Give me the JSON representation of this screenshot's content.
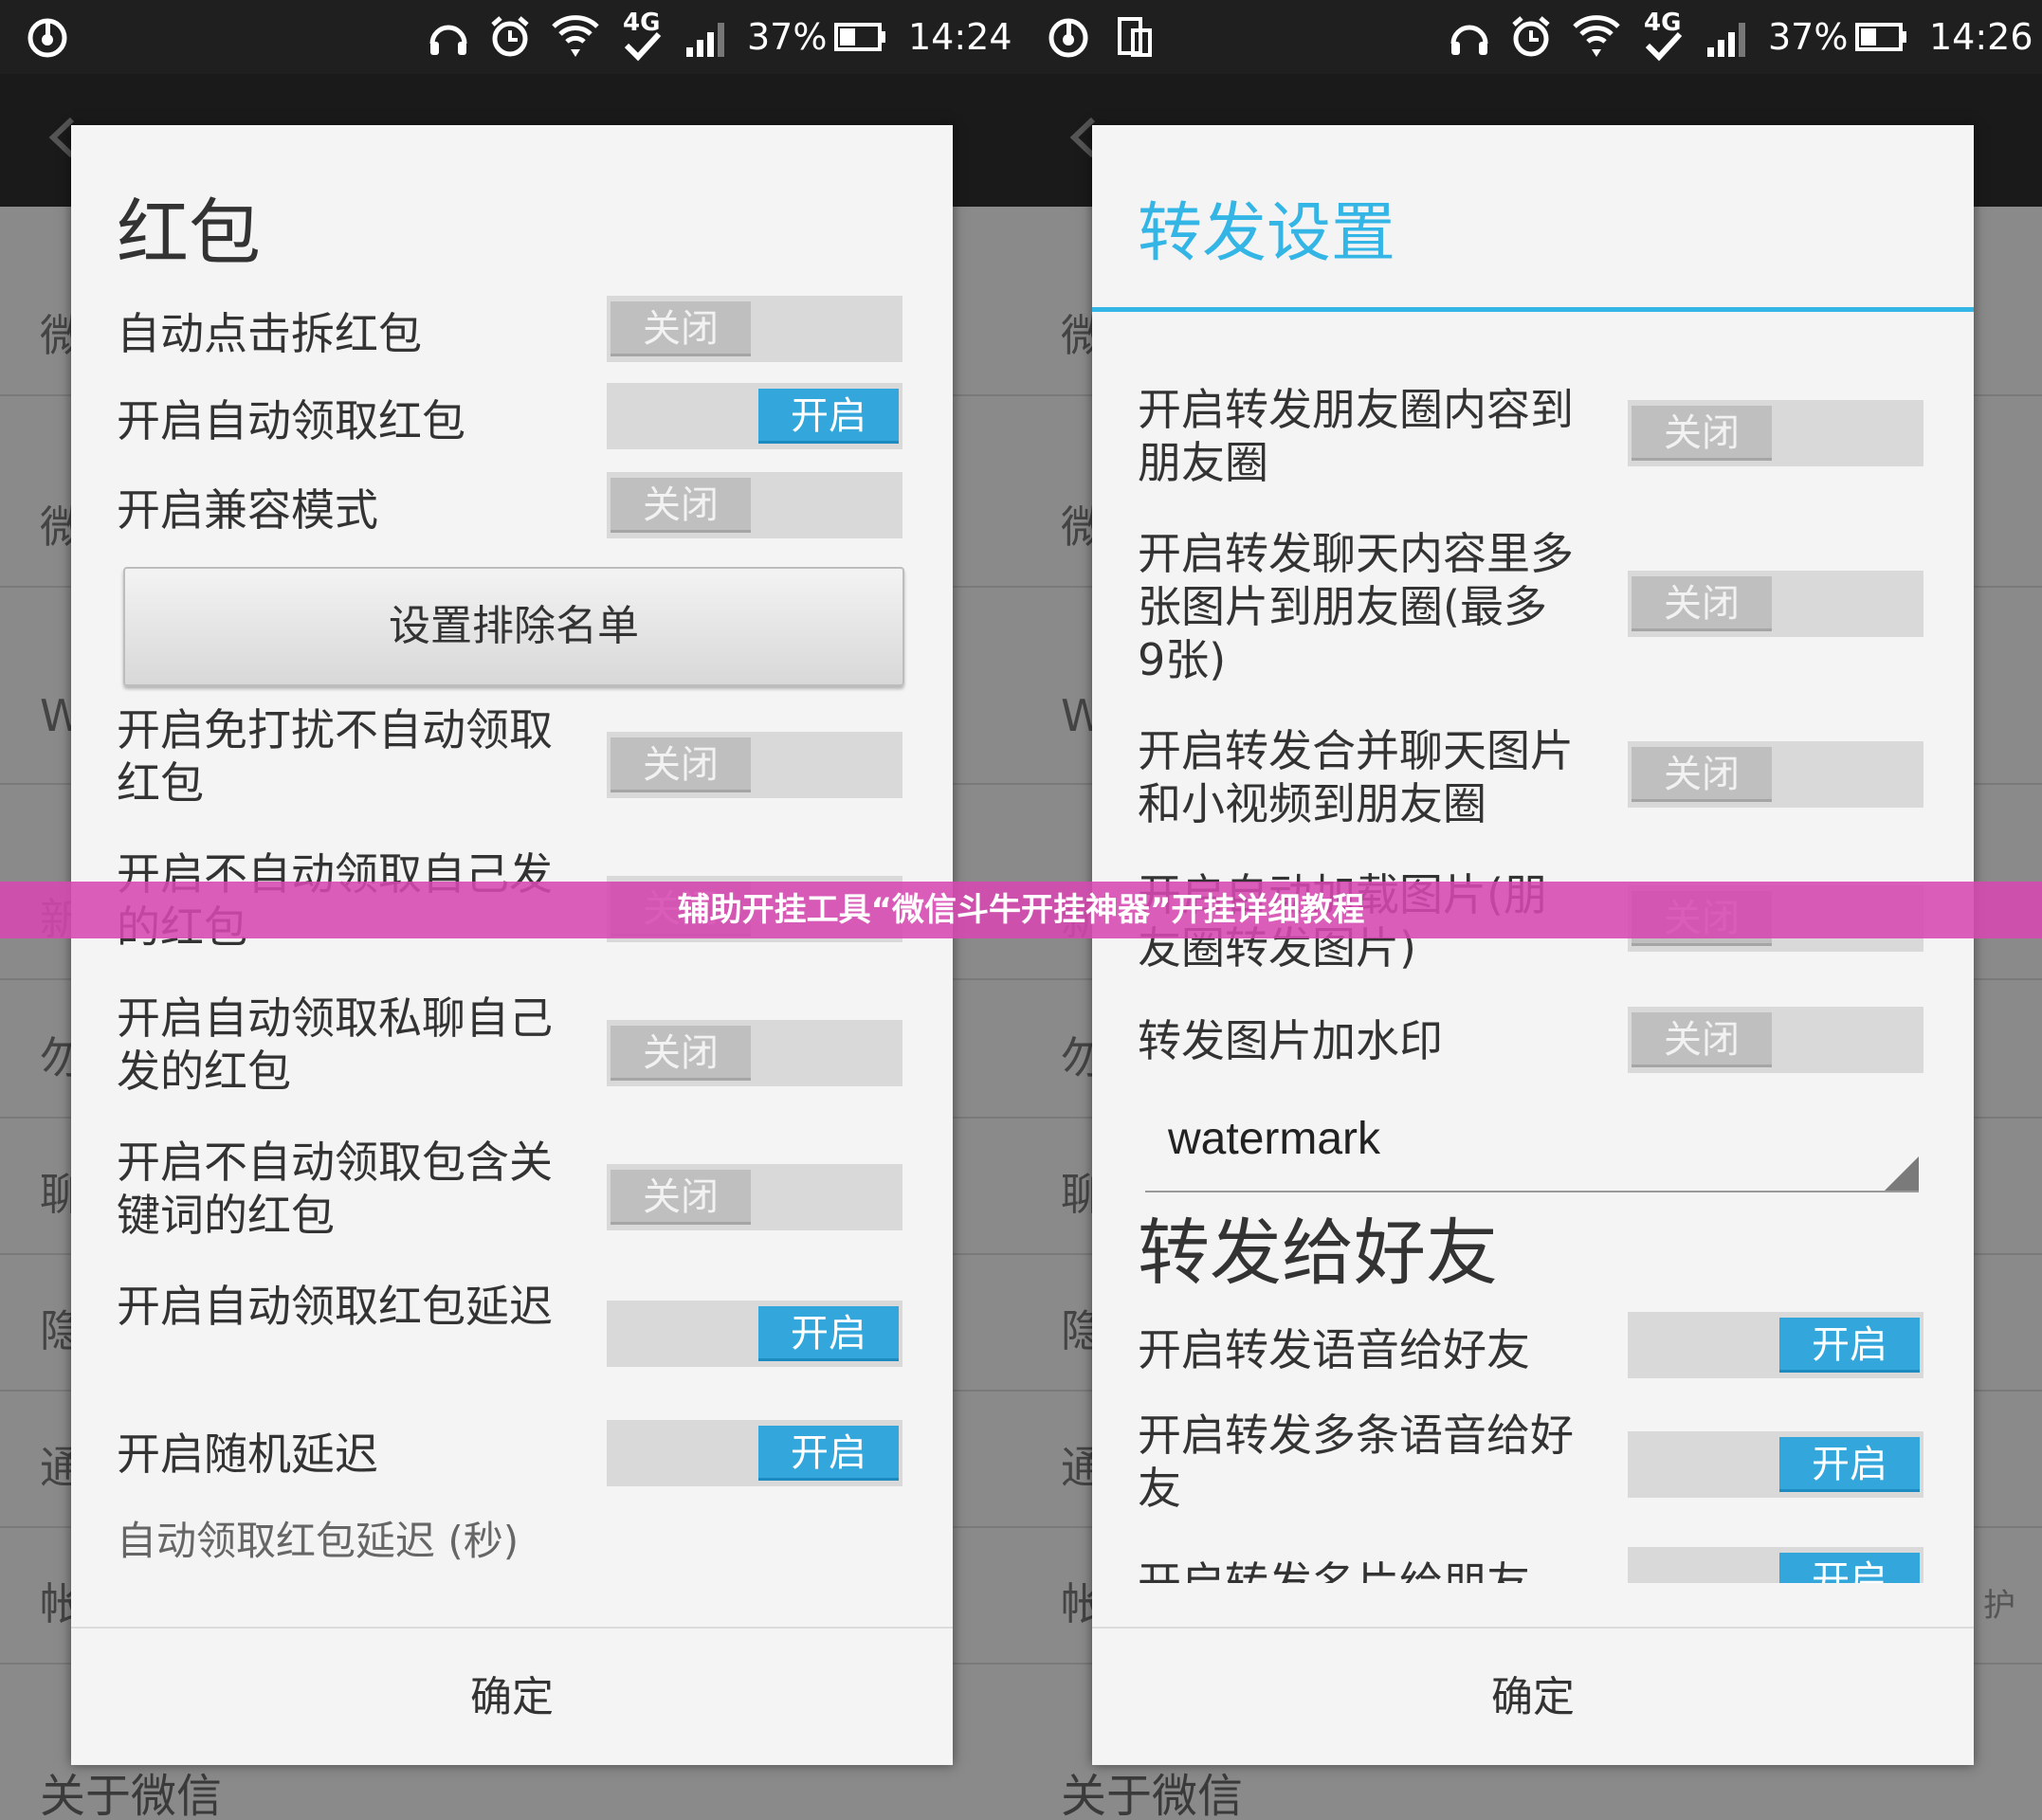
{
  "left_screen": {
    "status": {
      "battery": "37%",
      "time": "14:24",
      "network": "4G"
    },
    "bg_rows": [
      "微",
      "微",
      "W",
      "新",
      "勿",
      "聊",
      "隐",
      "通",
      "帐"
    ],
    "bg_bottom": "关于微信",
    "dialog": {
      "title": "红包",
      "rows": [
        {
          "label": "自动点击拆红包",
          "state": "关闭"
        },
        {
          "label": "开启自动领取红包",
          "state": "开启"
        },
        {
          "label": "开启兼容模式",
          "state": "关闭"
        },
        {
          "label": "开启免打扰不自动领取红包",
          "state": "关闭"
        },
        {
          "label": "开启不自动领取自己发的红包",
          "state": "关闭"
        },
        {
          "label": "开启自动领取私聊自己发的红包",
          "state": "关闭"
        },
        {
          "label": "开启不自动领取包含关键词的红包",
          "state": "关闭"
        },
        {
          "label": "开启自动领取红包延迟",
          "state": "开启"
        },
        {
          "label": "开启随机延迟",
          "state": "开启"
        }
      ],
      "exclude_button": "设置排除名单",
      "hint": "自动领取红包延迟 (秒)",
      "ok": "确定"
    }
  },
  "right_screen": {
    "status": {
      "battery": "37%",
      "time": "14:26",
      "network": "4G"
    },
    "bg_rows": [
      "微",
      "微",
      "W",
      "新",
      "勿",
      "聊",
      "隐",
      "通",
      "帐"
    ],
    "bg_right_text": "护",
    "bg_bottom": "关于微信",
    "dialog": {
      "title": "转发设置",
      "rows": [
        {
          "label": "开启转发朋友圈内容到朋友圈",
          "state": "关闭"
        },
        {
          "label": "开启转发聊天内容里多张图片到朋友圈(最多9张)",
          "state": "关闭"
        },
        {
          "label": "开启转发合并聊天图片和小视频到朋友圈",
          "state": "关闭"
        },
        {
          "label": "开启自动加载图片(朋友圈转发图片)",
          "state": "关闭"
        },
        {
          "label": "转发图片加水印",
          "state": "关闭"
        }
      ],
      "watermark_value": "watermark",
      "section2_title": "转发给好友",
      "rows2": [
        {
          "label": "开启转发语音给好友",
          "state": "开启"
        },
        {
          "label": "开启转发多条语音给好友",
          "state": "开启"
        },
        {
          "label": "开启转发名片给朋友",
          "state": "开启"
        }
      ],
      "ok": "确定"
    }
  },
  "banner": "辅助开挂工具“微信斗牛开挂神器”开挂详细教程",
  "colors": {
    "accent": "#33b5e5",
    "toggle_on": "#33a7dc",
    "banner": "#d649b0"
  }
}
